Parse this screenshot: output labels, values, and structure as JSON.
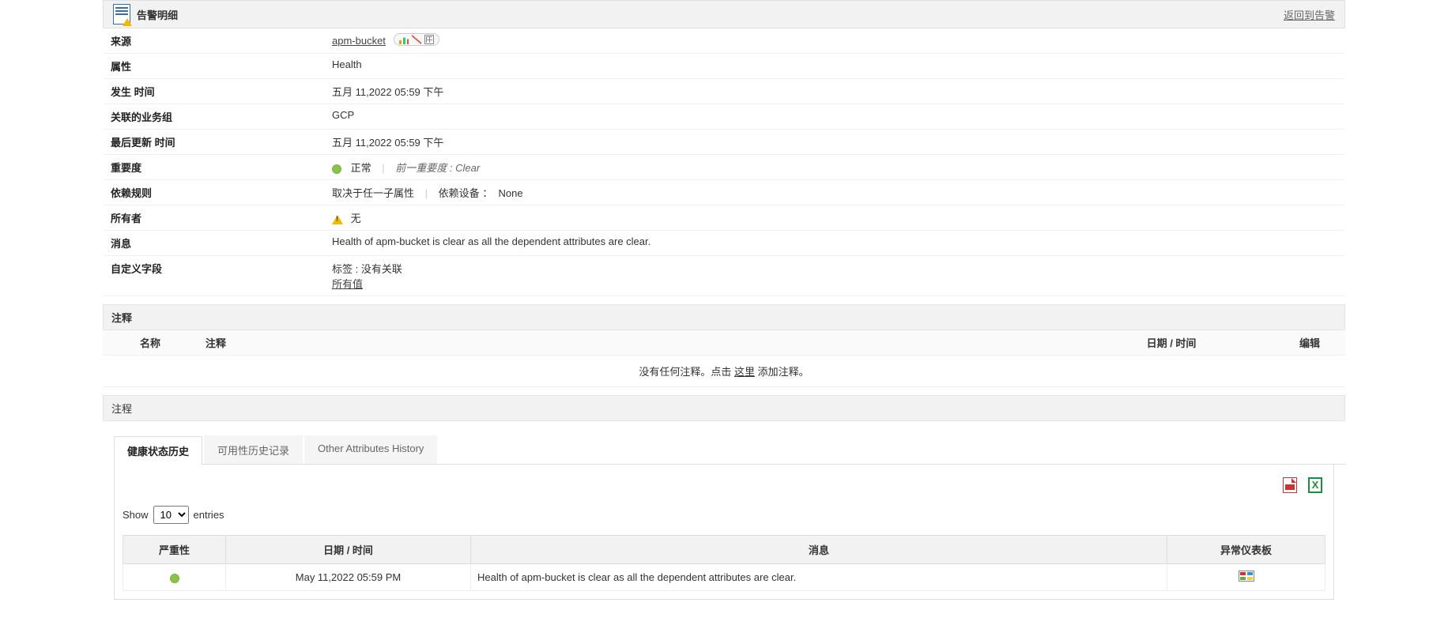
{
  "header": {
    "title": "告警明细",
    "back_link": "返回到告警"
  },
  "details": {
    "source_label": "来源",
    "source_value": "apm-bucket",
    "attribute_label": "属性",
    "attribute_value": "Health",
    "occurred_label": "发生 时间",
    "occurred_value": "五月 11,2022 05:59 下午",
    "group_label": "关联的业务组",
    "group_value": "GCP",
    "updated_label": "最后更新 时间",
    "updated_value": "五月 11,2022 05:59 下午",
    "severity_label": "重要度",
    "severity_value": "正常",
    "severity_prev_label": "前一重要度 :",
    "severity_prev_value": "Clear",
    "deprule_label": "依赖规则",
    "deprule_value": "取决于任一子属性",
    "depdev_label": "依赖设备 ：",
    "depdev_value": "None",
    "owner_label": "所有者",
    "owner_value": "无",
    "message_label": "消息",
    "message_value": "Health of apm-bucket is clear as all the dependent attributes are clear.",
    "custom_label": "自定义字段",
    "custom_tag_line": "标签 : 没有关联",
    "custom_all": "所有值"
  },
  "annotations": {
    "section_title": "注释",
    "col_name": "名称",
    "col_anno": "注释",
    "col_date": "日期 / 时间",
    "col_edit": "编辑",
    "empty_prefix": "没有任何注释。点击 ",
    "empty_link": "这里",
    "empty_suffix": "添加注释。",
    "note_title": "注程"
  },
  "tabs": {
    "t1": "健康状态历史",
    "t2": "可用性历史记录",
    "t3": "Other Attributes History"
  },
  "history": {
    "show_label": "Show",
    "entries_label": "entries",
    "page_size": "10",
    "col_severity": "严重性",
    "col_datetime": "日期 / 时间",
    "col_message": "消息",
    "col_dashboard": "异常仪表板",
    "rows": [
      {
        "datetime": "May 11,2022 05:59 PM",
        "message": "Health of apm-bucket is clear as all the dependent attributes are clear."
      }
    ]
  }
}
